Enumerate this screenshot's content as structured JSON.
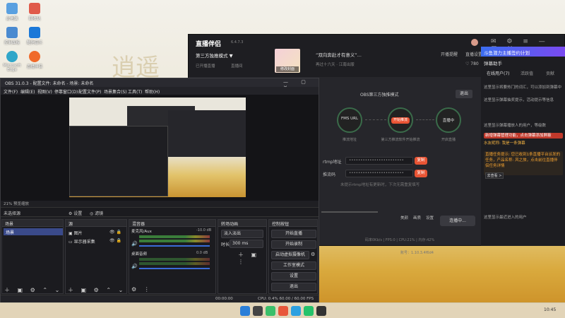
{
  "desktop": {
    "icons": [
      "此电脑",
      "回收站",
      "控制面板",
      "酷狗音乐",
      "Microsoft Edge",
      "直播伴侣"
    ]
  },
  "live": {
    "title": "直播伴侣",
    "version": "6.4.7.3",
    "mode": "第三方独推模式 ▼",
    "subtitles": [
      "已开播直播",
      "直播间"
    ],
    "promo_text": "“双向奔赴才有意义”...",
    "promo_sub": "再过十六天 · 江南出版",
    "change_cover": "修改封面",
    "top_actions": [
      "开播提醒",
      "直播设置",
      "♡ 780"
    ],
    "obs_mode_title": "OBS第三方独推模式",
    "exit": "退出",
    "steps": [
      {
        "label": "FMS URL",
        "sub": "推流地址"
      },
      {
        "label": "开始推流",
        "sub": "第三方推流软件开始推流"
      },
      {
        "label": "直播中",
        "sub": "开启直播"
      }
    ],
    "rtmp_label": "rtmp地址",
    "rtmp_value": "••••••••••••••••••••••••",
    "key_label": "推流码",
    "key_value": "••••••••••••••••••••••••",
    "copy": "复制",
    "hint": "未提示rtmp地址有更新时，下次无需重复填写",
    "bottom_tools": [
      "美颜",
      "画质",
      "设置"
    ],
    "start_btn": "连播中...",
    "stats": "码率0Kb/s  |  FPS:0  |  CPU:21%  |  内存:42%",
    "uid": "账号：1.10.3.4f6d4"
  },
  "right_panel": {
    "banner": "斗鱼潜力主播签约计划",
    "section": "弹幕助手",
    "tabs": [
      "在线用户(7)",
      "活跃值",
      "贡献"
    ],
    "messages": [
      "这里显示将要热门的词汇，可以添加到弹幕中",
      "这里显示弹幕抽奖提示，活动提示等信息",
      "这里显示弹幕播放人的用户，等级数",
      "新增弹幕管理功能，点击弹幕添加屏蔽",
      "水友昵称: 我是一条弹幕",
      "直播任务提示: 您已收到1条直播平台派发的任务，产品名称: 风之旅，点击前往直播伴侣任务详情",
      "这里显示最近进入的用户"
    ],
    "view_btn": "去查看 >"
  },
  "obs": {
    "title": "OBS 31.0.3 - 配置文件: 未命名 - 场景: 未命名",
    "menu": [
      "文件(F)",
      "编辑(E)",
      "视图(V)",
      "停靠窗口(D)",
      "配置文件(P)",
      "场景集合(S)",
      "工具(T)",
      "帮助(H)"
    ],
    "zoom": "21%",
    "zoom_label": "预览缩放",
    "no_source": "未选择源",
    "props": "⚙ 设置",
    "filters": "◎ 滤镜",
    "docks": {
      "scenes": "场景",
      "sources": "源",
      "mixer": "混音器",
      "transitions": "转场动画",
      "controls": "控制按钮"
    },
    "scene_items": [
      "场景"
    ],
    "source_items": [
      "图片",
      "显示器采集"
    ],
    "mixer": [
      {
        "name": "麦克风/Aux",
        "db": "-10.0 dB"
      },
      {
        "name": "桌面音频",
        "db": "0.0 dB"
      }
    ],
    "transition": "淡入淡出",
    "duration_label": "时长",
    "duration": "300 ms",
    "controls": [
      "开始直播",
      "开始录制",
      "启动虚拟摄像机",
      "工作室模式",
      "设置",
      "退出"
    ],
    "status": "CPU: 0.4%   60.00 / 60.00 FPS",
    "timecodes": "00:00:00"
  },
  "clock": "10:45"
}
